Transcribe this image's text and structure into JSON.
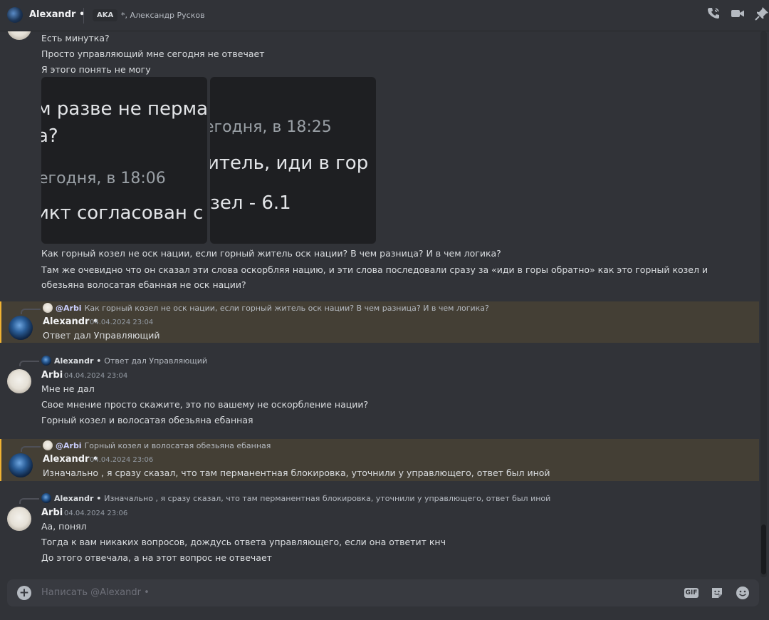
{
  "header": {
    "name": "Alexandr •",
    "aka_badge": "AKA",
    "aka_names": "*, Александр Русков"
  },
  "first_block": {
    "lines": [
      "Есть минутка?",
      "Просто управляющий мне сегодня не отвечает",
      "Я этого понять не могу"
    ],
    "image1": {
      "line1": "м разве не перман",
      "line2": "а?",
      "line3": "егодня, в 18:06",
      "line4": "икт согласован с"
    },
    "image2": {
      "line1": "егодня, в 18:25",
      "line2": "итель, иди в гор",
      "line3": "зел - 6.1"
    },
    "after_lines": [
      "Как горный козел не оск нации, если горный житель оск нации? В чем разница? И в чем логика?",
      "Там же очевидно что он сказал эти слова оскорбляя нацию, и эти слова последовали сразу за «иди в горы обратно» как это горный козел и обезьяна волосатая ебанная не оск нации?"
    ]
  },
  "messages": [
    {
      "reply_name": "@Arbi",
      "reply_text": "Как горный козел не оск нации, если горный житель оск нации? В чем разница? И в чем логика?",
      "author": "Alexandr •",
      "timestamp": "04.04.2024 23:04",
      "lines": [
        "Ответ дал Управляющий"
      ]
    },
    {
      "reply_name": "Alexandr •",
      "reply_text": "Ответ дал Управляющий",
      "author": "Arbi",
      "timestamp": "04.04.2024 23:04",
      "lines": [
        "Мне не дал",
        "Свое мнение просто скажите, это по вашему не оскорбление нации?",
        "Горный козел и волосатая обезьяна ебанная"
      ]
    },
    {
      "reply_name": "@Arbi",
      "reply_text": "Горный козел и волосатая обезьяна ебанная",
      "author": "Alexandr •",
      "timestamp": "04.04.2024 23:06",
      "lines": [
        "Изначально , я сразу сказал, что там перманентная блокировка, уточнили у управлющего, ответ был иной"
      ]
    },
    {
      "reply_name": "Alexandr •",
      "reply_text": "Изначально , я сразу сказал, что там перманентная блокировка, уточнили у управлющего, ответ был иной",
      "author": "Arbi",
      "timestamp": "04.04.2024 23:06",
      "lines": [
        "Аа, понял",
        "Тогда к вам никаких вопросов, дождусь ответа управляющего, если она ответит кнч",
        "До этого отвечала, а на этот вопрос не отвечает"
      ]
    }
  ],
  "composer": {
    "placeholder": "Написать @Alexandr •",
    "gif_label": "GIF"
  },
  "icons": {
    "header": [
      "phone-call-icon",
      "video-call-icon",
      "pin-icon"
    ],
    "composer": [
      "add-attachment-icon",
      "gif-icon",
      "sticker-icon",
      "emoji-icon"
    ]
  },
  "colors": {
    "background": "#313338",
    "mention_highlight": "#443f35",
    "mention_border": "#f0b232"
  }
}
